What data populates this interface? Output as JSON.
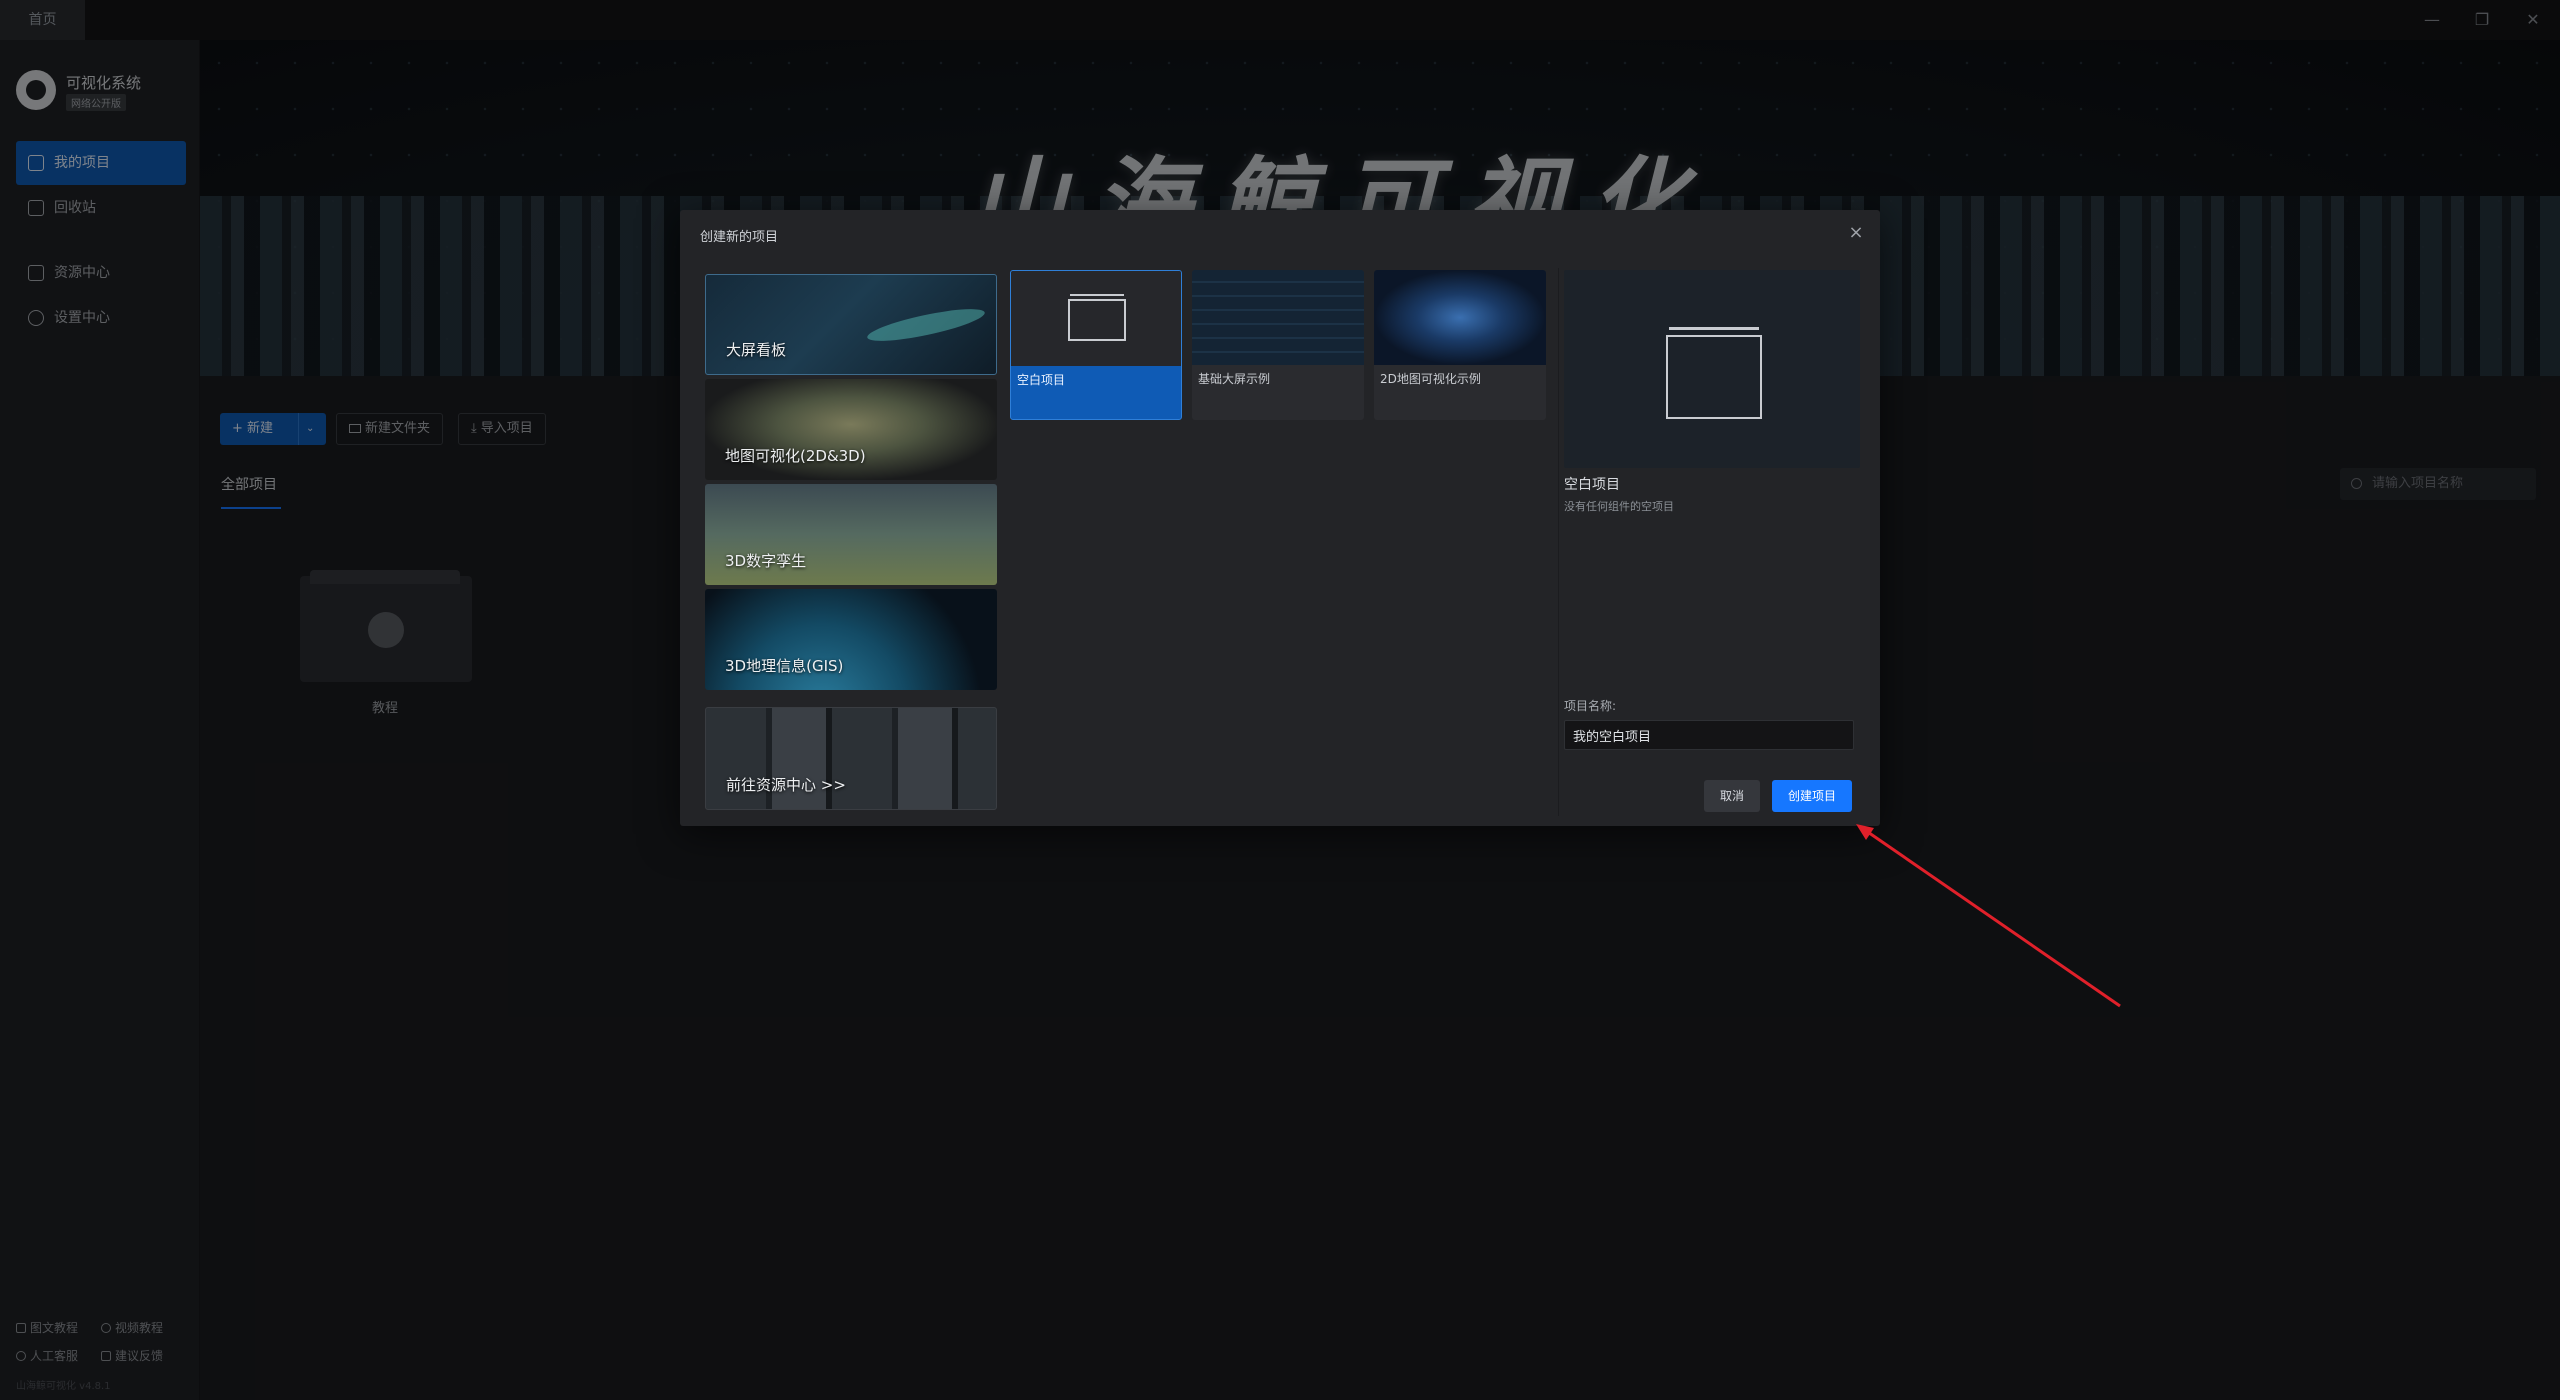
{
  "titlebar": {
    "tab_label": "首页",
    "minimize_glyph": "—",
    "restore_glyph": "❐",
    "close_glyph": "✕"
  },
  "sidebar": {
    "app_name": "可视化系统",
    "app_badge": "网络公开版",
    "items": [
      {
        "label": "我的项目",
        "icon": "monitor-icon",
        "active": true
      },
      {
        "label": "回收站",
        "icon": "trash-icon"
      },
      {
        "label": "资源中心",
        "icon": "cube-icon"
      },
      {
        "label": "设置中心",
        "icon": "gear-icon"
      }
    ],
    "footer": [
      {
        "label": "图文教程",
        "icon": "book-icon"
      },
      {
        "label": "视频教程",
        "icon": "play-icon"
      },
      {
        "label": "人工客服",
        "icon": "user-icon"
      },
      {
        "label": "建议反馈",
        "icon": "feedback-icon"
      }
    ],
    "version": "山海鲸可视化 v4.8.1"
  },
  "banner": {
    "title": "山海鲸可视化"
  },
  "toolbar": {
    "new_label": "+ 新建",
    "new_dropdown": "⌄",
    "new_folder_label": "新建文件夹",
    "import_label": "导入项目"
  },
  "tabs": {
    "all_projects": "全部项目"
  },
  "search": {
    "placeholder": "请输入项目名称"
  },
  "folders": [
    {
      "label": "教程"
    }
  ],
  "modal": {
    "title": "创建新的项目",
    "close_glyph": "×",
    "categories": [
      {
        "label": "大屏看板",
        "selected": true
      },
      {
        "label": "地图可视化(2D&3D)"
      },
      {
        "label": "3D数字孪生"
      },
      {
        "label": "3D地理信息(GIS)"
      },
      {
        "label": "前往资源中心 >>"
      }
    ],
    "templates": [
      {
        "label": "空白项目",
        "selected": true
      },
      {
        "label": "基础大屏示例"
      },
      {
        "label": "2D地图可视化示例"
      }
    ],
    "preview": {
      "name": "空白项目",
      "description": "没有任何组件的空项目"
    },
    "field_label": "项目名称:",
    "field_value": "我的空白项目",
    "cancel_label": "取消",
    "create_label": "创建项目"
  },
  "colors": {
    "accent": "#1677ff",
    "sidebar_active": "#0f5bb5",
    "annotation_arrow": "#e0202a"
  }
}
